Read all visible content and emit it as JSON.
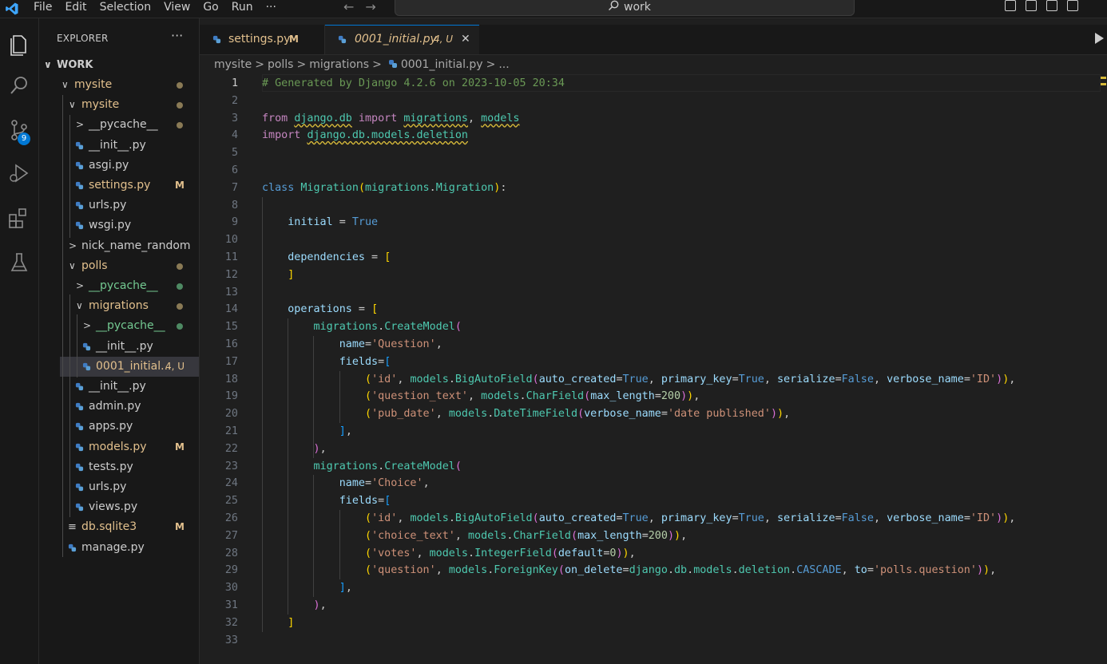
{
  "menu": [
    "File",
    "Edit",
    "Selection",
    "View",
    "Go",
    "Run",
    "···"
  ],
  "search": {
    "text": "work"
  },
  "activity": {
    "scm_badge": "9"
  },
  "explorer": {
    "title": "EXPLORER",
    "more": "···",
    "root": "WORK",
    "tree": [
      {
        "label": "mysite",
        "indent": 1,
        "type": "folder",
        "open": true,
        "color": "#e2c08d",
        "dot": "#8a7a55"
      },
      {
        "label": "mysite",
        "indent": 2,
        "type": "folder",
        "open": true,
        "color": "#e2c08d",
        "dot": "#8a7a55"
      },
      {
        "label": "__pycache__",
        "indent": 3,
        "type": "folder",
        "open": false,
        "color": "#cccccc",
        "dot": "#8a7a55"
      },
      {
        "label": "__init__.py",
        "indent": 3,
        "type": "file",
        "color": "#cccccc"
      },
      {
        "label": "asgi.py",
        "indent": 3,
        "type": "file",
        "color": "#cccccc"
      },
      {
        "label": "settings.py",
        "indent": 3,
        "type": "file",
        "color": "#e2c08d",
        "status": "M"
      },
      {
        "label": "urls.py",
        "indent": 3,
        "type": "file",
        "color": "#cccccc"
      },
      {
        "label": "wsgi.py",
        "indent": 3,
        "type": "file",
        "color": "#cccccc"
      },
      {
        "label": "nick_name_random",
        "indent": 2,
        "type": "folder",
        "open": false,
        "color": "#cccccc"
      },
      {
        "label": "polls",
        "indent": 2,
        "type": "folder",
        "open": true,
        "color": "#e2c08d",
        "dot": "#8a7a55"
      },
      {
        "label": "__pycache__",
        "indent": 3,
        "type": "folder",
        "open": false,
        "color": "#73c991",
        "dot": "#4e8a63"
      },
      {
        "label": "migrations",
        "indent": 3,
        "type": "folder",
        "open": true,
        "color": "#e2c08d",
        "dot": "#8a7a55"
      },
      {
        "label": "__pycache__",
        "indent": 4,
        "type": "folder",
        "open": false,
        "color": "#73c991",
        "dot": "#4e8a63"
      },
      {
        "label": "__init__.py",
        "indent": 4,
        "type": "file",
        "color": "#cccccc"
      },
      {
        "label": "0001_initial...",
        "indent": 4,
        "type": "file",
        "color": "#e2c08d",
        "status": "4, U",
        "selected": true
      },
      {
        "label": "__init__.py",
        "indent": 3,
        "type": "file",
        "color": "#cccccc"
      },
      {
        "label": "admin.py",
        "indent": 3,
        "type": "file",
        "color": "#cccccc"
      },
      {
        "label": "apps.py",
        "indent": 3,
        "type": "file",
        "color": "#cccccc"
      },
      {
        "label": "models.py",
        "indent": 3,
        "type": "file",
        "color": "#e2c08d",
        "status": "M"
      },
      {
        "label": "tests.py",
        "indent": 3,
        "type": "file",
        "color": "#cccccc"
      },
      {
        "label": "urls.py",
        "indent": 3,
        "type": "file",
        "color": "#cccccc"
      },
      {
        "label": "views.py",
        "indent": 3,
        "type": "file",
        "color": "#cccccc"
      },
      {
        "label": "db.sqlite3",
        "indent": 2,
        "type": "db",
        "color": "#e2c08d",
        "status": "M"
      },
      {
        "label": "manage.py",
        "indent": 2,
        "type": "file",
        "color": "#cccccc"
      }
    ]
  },
  "tabs": [
    {
      "label": "settings.py",
      "status": "M",
      "color": "#e2c08d",
      "active": false
    },
    {
      "label": "0001_initial.py",
      "status": "4, U",
      "color": "#e2c08d",
      "active": true,
      "close": "✕"
    }
  ],
  "breadcrumb": [
    "mysite",
    ">",
    "polls",
    ">",
    "migrations",
    ">",
    "0001_initial.py",
    ">",
    "..."
  ],
  "code": [
    [
      [
        "c-com",
        "# Generated by Django 4.2.6 on 2023-10-05 20:34"
      ]
    ],
    [],
    [
      [
        "c-kw",
        "from "
      ],
      [
        "c-cls sq",
        "django.db"
      ],
      [
        "c-kw",
        " import "
      ],
      [
        "c-cls sq",
        "migrations"
      ],
      [
        "",
        ", "
      ],
      [
        "c-cls sq",
        "models"
      ]
    ],
    [
      [
        "c-kw",
        "import "
      ],
      [
        "c-cls sq",
        "django.db.models.deletion"
      ]
    ],
    [],
    [],
    [
      [
        "c-con",
        "class "
      ],
      [
        "c-cls",
        "Migration"
      ],
      [
        "b1",
        "("
      ],
      [
        "c-cls",
        "migrations"
      ],
      [
        "",
        "."
      ],
      [
        "c-cls",
        "Migration"
      ],
      [
        "b1",
        ")"
      ],
      [
        "",
        ":"
      ]
    ],
    [],
    [
      [
        "",
        "    "
      ],
      [
        "c-var",
        "initial"
      ],
      [
        "",
        " = "
      ],
      [
        "c-con",
        "True"
      ]
    ],
    [],
    [
      [
        "",
        "    "
      ],
      [
        "c-var",
        "dependencies"
      ],
      [
        "",
        " = "
      ],
      [
        "b1",
        "["
      ]
    ],
    [
      [
        "",
        "    "
      ],
      [
        "b1",
        "]"
      ]
    ],
    [],
    [
      [
        "",
        "    "
      ],
      [
        "c-var",
        "operations"
      ],
      [
        "",
        " = "
      ],
      [
        "b1",
        "["
      ]
    ],
    [
      [
        "",
        "        "
      ],
      [
        "c-cls",
        "migrations"
      ],
      [
        "",
        "."
      ],
      [
        "c-cls",
        "CreateModel"
      ],
      [
        "b2",
        "("
      ]
    ],
    [
      [
        "",
        "            "
      ],
      [
        "c-var",
        "name"
      ],
      [
        "",
        "="
      ],
      [
        "c-str",
        "'Question'"
      ],
      [
        "",
        ","
      ]
    ],
    [
      [
        "",
        "            "
      ],
      [
        "c-var",
        "fields"
      ],
      [
        "",
        "="
      ],
      [
        "b3",
        "["
      ]
    ],
    [
      [
        "",
        "                "
      ],
      [
        "b1",
        "("
      ],
      [
        "c-str",
        "'id'"
      ],
      [
        "",
        ", "
      ],
      [
        "c-cls",
        "models"
      ],
      [
        "",
        "."
      ],
      [
        "c-cls",
        "BigAutoField"
      ],
      [
        "b2",
        "("
      ],
      [
        "c-var",
        "auto_created"
      ],
      [
        "",
        "="
      ],
      [
        "c-con",
        "True"
      ],
      [
        "",
        ", "
      ],
      [
        "c-var",
        "primary_key"
      ],
      [
        "",
        "="
      ],
      [
        "c-con",
        "True"
      ],
      [
        "",
        ", "
      ],
      [
        "c-var",
        "serialize"
      ],
      [
        "",
        "="
      ],
      [
        "c-con",
        "False"
      ],
      [
        "",
        ", "
      ],
      [
        "c-var",
        "verbose_name"
      ],
      [
        "",
        "="
      ],
      [
        "c-str",
        "'ID'"
      ],
      [
        "b2",
        ")"
      ],
      [
        "b1",
        ")"
      ],
      [
        "",
        ","
      ]
    ],
    [
      [
        "",
        "                "
      ],
      [
        "b1",
        "("
      ],
      [
        "c-str",
        "'question_text'"
      ],
      [
        "",
        ", "
      ],
      [
        "c-cls",
        "models"
      ],
      [
        "",
        "."
      ],
      [
        "c-cls",
        "CharField"
      ],
      [
        "b2",
        "("
      ],
      [
        "c-var",
        "max_length"
      ],
      [
        "",
        "="
      ],
      [
        "c-num",
        "200"
      ],
      [
        "b2",
        ")"
      ],
      [
        "b1",
        ")"
      ],
      [
        "",
        ","
      ]
    ],
    [
      [
        "",
        "                "
      ],
      [
        "b1",
        "("
      ],
      [
        "c-str",
        "'pub_date'"
      ],
      [
        "",
        ", "
      ],
      [
        "c-cls",
        "models"
      ],
      [
        "",
        "."
      ],
      [
        "c-cls",
        "DateTimeField"
      ],
      [
        "b2",
        "("
      ],
      [
        "c-var",
        "verbose_name"
      ],
      [
        "",
        "="
      ],
      [
        "c-str",
        "'date published'"
      ],
      [
        "b2",
        ")"
      ],
      [
        "b1",
        ")"
      ],
      [
        "",
        ","
      ]
    ],
    [
      [
        "",
        "            "
      ],
      [
        "b3",
        "]"
      ],
      [
        "",
        ","
      ]
    ],
    [
      [
        "",
        "        "
      ],
      [
        "b2",
        ")"
      ],
      [
        "",
        ","
      ]
    ],
    [
      [
        "",
        "        "
      ],
      [
        "c-cls",
        "migrations"
      ],
      [
        "",
        "."
      ],
      [
        "c-cls",
        "CreateModel"
      ],
      [
        "b2",
        "("
      ]
    ],
    [
      [
        "",
        "            "
      ],
      [
        "c-var",
        "name"
      ],
      [
        "",
        "="
      ],
      [
        "c-str",
        "'Choice'"
      ],
      [
        "",
        ","
      ]
    ],
    [
      [
        "",
        "            "
      ],
      [
        "c-var",
        "fields"
      ],
      [
        "",
        "="
      ],
      [
        "b3",
        "["
      ]
    ],
    [
      [
        "",
        "                "
      ],
      [
        "b1",
        "("
      ],
      [
        "c-str",
        "'id'"
      ],
      [
        "",
        ", "
      ],
      [
        "c-cls",
        "models"
      ],
      [
        "",
        "."
      ],
      [
        "c-cls",
        "BigAutoField"
      ],
      [
        "b2",
        "("
      ],
      [
        "c-var",
        "auto_created"
      ],
      [
        "",
        "="
      ],
      [
        "c-con",
        "True"
      ],
      [
        "",
        ", "
      ],
      [
        "c-var",
        "primary_key"
      ],
      [
        "",
        "="
      ],
      [
        "c-con",
        "True"
      ],
      [
        "",
        ", "
      ],
      [
        "c-var",
        "serialize"
      ],
      [
        "",
        "="
      ],
      [
        "c-con",
        "False"
      ],
      [
        "",
        ", "
      ],
      [
        "c-var",
        "verbose_name"
      ],
      [
        "",
        "="
      ],
      [
        "c-str",
        "'ID'"
      ],
      [
        "b2",
        ")"
      ],
      [
        "b1",
        ")"
      ],
      [
        "",
        ","
      ]
    ],
    [
      [
        "",
        "                "
      ],
      [
        "b1",
        "("
      ],
      [
        "c-str",
        "'choice_text'"
      ],
      [
        "",
        ", "
      ],
      [
        "c-cls",
        "models"
      ],
      [
        "",
        "."
      ],
      [
        "c-cls",
        "CharField"
      ],
      [
        "b2",
        "("
      ],
      [
        "c-var",
        "max_length"
      ],
      [
        "",
        "="
      ],
      [
        "c-num",
        "200"
      ],
      [
        "b2",
        ")"
      ],
      [
        "b1",
        ")"
      ],
      [
        "",
        ","
      ]
    ],
    [
      [
        "",
        "                "
      ],
      [
        "b1",
        "("
      ],
      [
        "c-str",
        "'votes'"
      ],
      [
        "",
        ", "
      ],
      [
        "c-cls",
        "models"
      ],
      [
        "",
        "."
      ],
      [
        "c-cls",
        "IntegerField"
      ],
      [
        "b2",
        "("
      ],
      [
        "c-var",
        "default"
      ],
      [
        "",
        "="
      ],
      [
        "c-num",
        "0"
      ],
      [
        "b2",
        ")"
      ],
      [
        "b1",
        ")"
      ],
      [
        "",
        ","
      ]
    ],
    [
      [
        "",
        "                "
      ],
      [
        "b1",
        "("
      ],
      [
        "c-str",
        "'question'"
      ],
      [
        "",
        ", "
      ],
      [
        "c-cls",
        "models"
      ],
      [
        "",
        "."
      ],
      [
        "c-cls",
        "ForeignKey"
      ],
      [
        "b2",
        "("
      ],
      [
        "c-var",
        "on_delete"
      ],
      [
        "",
        "="
      ],
      [
        "c-cls",
        "django"
      ],
      [
        "",
        "."
      ],
      [
        "c-cls",
        "db"
      ],
      [
        "",
        "."
      ],
      [
        "c-cls",
        "models"
      ],
      [
        "",
        "."
      ],
      [
        "c-cls",
        "deletion"
      ],
      [
        "",
        "."
      ],
      [
        "c-con",
        "CASCADE"
      ],
      [
        "",
        ", "
      ],
      [
        "c-var",
        "to"
      ],
      [
        "",
        "="
      ],
      [
        "c-str",
        "'polls.question'"
      ],
      [
        "b2",
        ")"
      ],
      [
        "b1",
        ")"
      ],
      [
        "",
        ","
      ]
    ],
    [
      [
        "",
        "            "
      ],
      [
        "b3",
        "]"
      ],
      [
        "",
        ","
      ]
    ],
    [
      [
        "",
        "        "
      ],
      [
        "b2",
        ")"
      ],
      [
        "",
        ","
      ]
    ],
    [
      [
        "",
        "    "
      ],
      [
        "b1",
        "]"
      ]
    ],
    []
  ]
}
